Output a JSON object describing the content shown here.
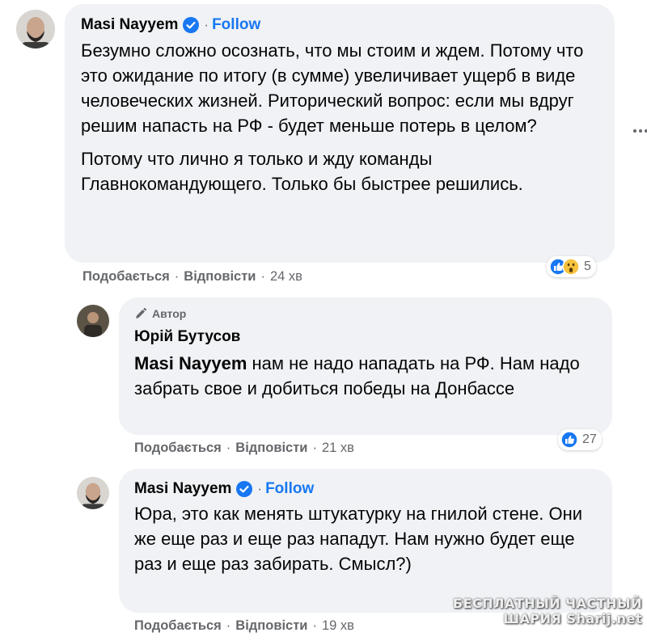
{
  "comments": [
    {
      "author": "Masi Nayyem",
      "verified": true,
      "separator": "·",
      "follow_label": "Follow",
      "paragraphs": [
        "Безумно сложно осознать, что мы стоим и ждем. Потому что это ожидание по итогу (в сумме) увеличивает ущерб в виде человеческих жизней. Риторический вопрос: если мы вдруг решим напасть на РФ - будет меньше потерь в целом?",
        "Потому что лично я только и жду команды Главнокомандующего. Только бы быстрее решились."
      ],
      "actions": {
        "like": "Подобається",
        "reply": "Відповісти",
        "time": "24 хв"
      },
      "reactions": {
        "icons": [
          "like-icon",
          "wow-icon"
        ],
        "count": "5"
      }
    },
    {
      "badge": "Автор",
      "author": "Юрій Бутусов",
      "mention": "Masi Nayyem",
      "text": " нам не надо нападать на РФ. Нам надо забрать свое и добиться победы на Донбассе",
      "actions": {
        "like": "Подобається",
        "reply": "Відповісти",
        "time": "21 хв"
      },
      "reactions": {
        "icons": [
          "like-icon"
        ],
        "count": "27"
      }
    },
    {
      "author": "Masi Nayyem",
      "verified": true,
      "separator": "·",
      "follow_label": "Follow",
      "text": "Юра, это как менять штукатурку на гнилой стене. Они же еще раз и еще раз нападут. Нам нужно будет еще раз и еще раз забирать. Смысл?)",
      "actions": {
        "like": "Подобається",
        "reply": "Відповісти",
        "time": "19 хв"
      }
    }
  ],
  "separator": "·",
  "watermark": {
    "line1": "БЕСПЛАТНЫЙ ЧАСТНЫЙ",
    "line2": "ШАРИЯ",
    "line3": "Sharij.net"
  },
  "colors": {
    "link": "#1877f2",
    "bubble": "#f0f2f5",
    "meta": "#65676b",
    "text": "#050505"
  }
}
